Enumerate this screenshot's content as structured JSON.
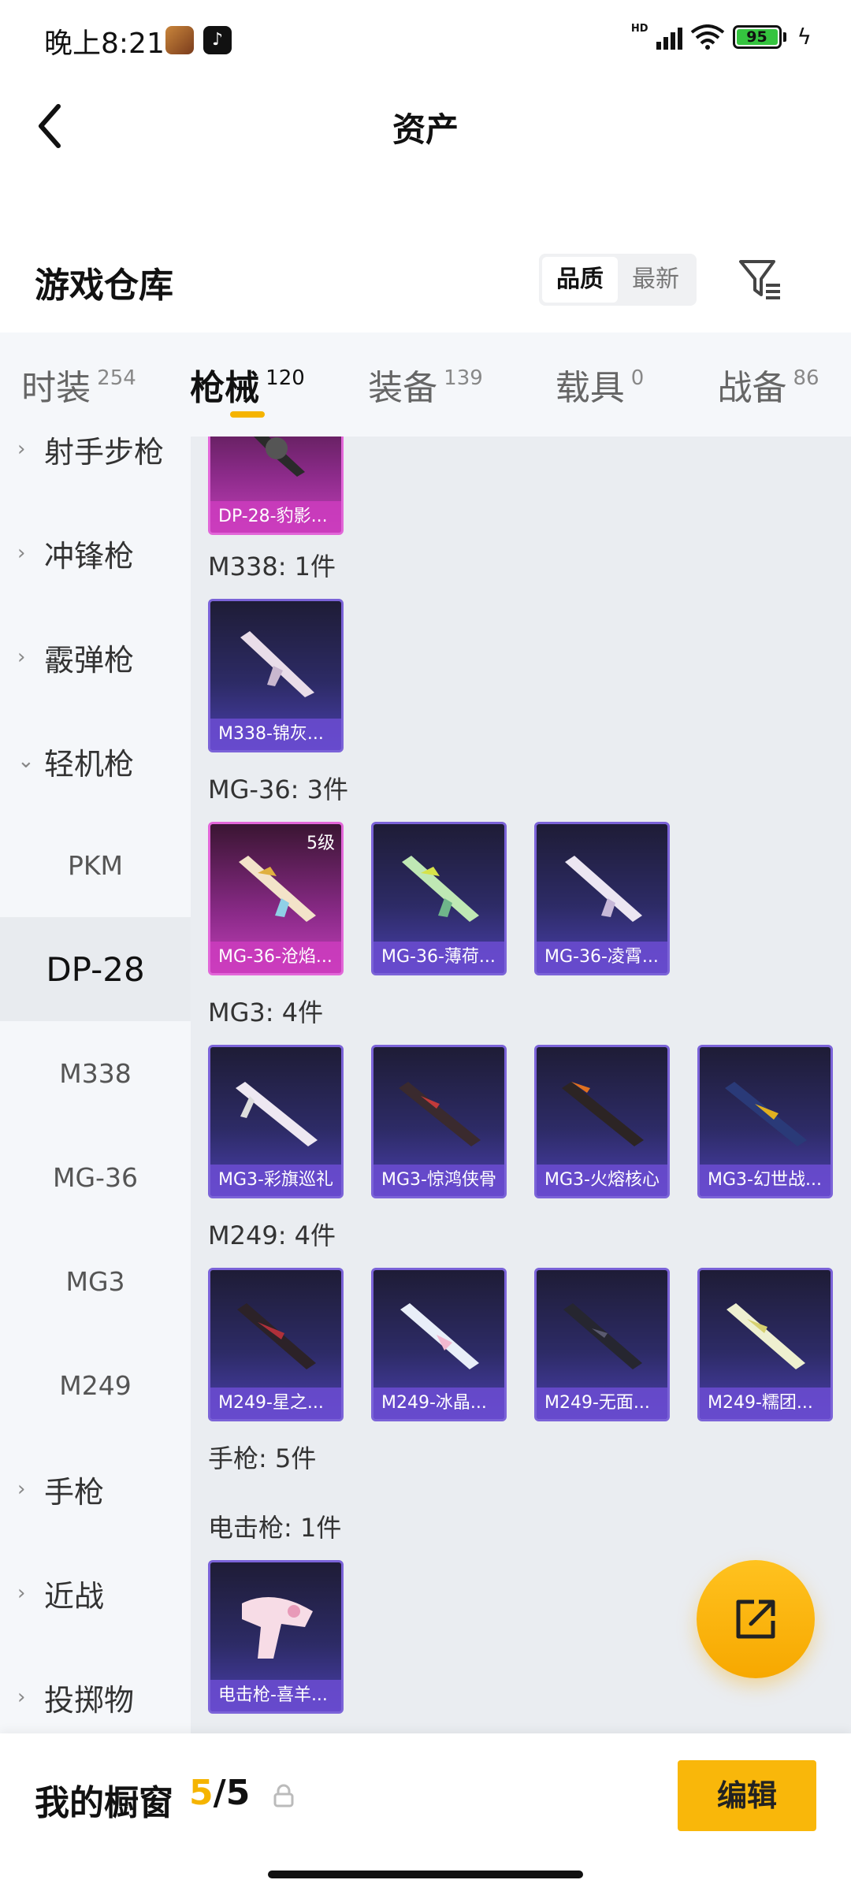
{
  "status": {
    "time": "晚上8:21",
    "hd": "HD",
    "battery": "95"
  },
  "header": {
    "title": "资产"
  },
  "warehouse": {
    "title": "游戏仓库",
    "sort_options": [
      "品质",
      "最新"
    ],
    "active_sort": "品质"
  },
  "tabs": [
    {
      "label": "时装",
      "count": "254"
    },
    {
      "label": "枪械",
      "count": "120"
    },
    {
      "label": "装备",
      "count": "139"
    },
    {
      "label": "载具",
      "count": "0"
    },
    {
      "label": "战备",
      "count": "86"
    }
  ],
  "active_tab": "枪械",
  "sidebar": {
    "items": [
      {
        "label": "射手步枪",
        "type": "category"
      },
      {
        "label": "冲锋枪",
        "type": "category"
      },
      {
        "label": "霰弹枪",
        "type": "category"
      },
      {
        "label": "轻机枪",
        "type": "category",
        "expanded": true
      },
      {
        "label": "PKM",
        "type": "sub"
      },
      {
        "label": "DP-28",
        "type": "sub",
        "selected": true
      },
      {
        "label": "M338",
        "type": "sub"
      },
      {
        "label": "MG-36",
        "type": "sub"
      },
      {
        "label": "MG3",
        "type": "sub"
      },
      {
        "label": "M249",
        "type": "sub"
      },
      {
        "label": "手枪",
        "type": "category"
      },
      {
        "label": "近战",
        "type": "category"
      },
      {
        "label": "投掷物",
        "type": "category"
      }
    ]
  },
  "groups": [
    {
      "title": "",
      "items": [
        {
          "name": "DP-28-豹影...",
          "rarity": "pink"
        }
      ]
    },
    {
      "title": "M338: 1件",
      "items": [
        {
          "name": "M338-锦灰...",
          "rarity": "purple"
        }
      ]
    },
    {
      "title": "MG-36: 3件",
      "items": [
        {
          "name": "MG-36-沧焰...",
          "rarity": "pink",
          "level": "5级"
        },
        {
          "name": "MG-36-薄荷...",
          "rarity": "purple"
        },
        {
          "name": "MG-36-凌霄...",
          "rarity": "purple"
        }
      ]
    },
    {
      "title": "MG3: 4件",
      "items": [
        {
          "name": "MG3-彩旗巡礼",
          "rarity": "purple"
        },
        {
          "name": "MG3-惊鸿侠骨",
          "rarity": "purple"
        },
        {
          "name": "MG3-火熔核心",
          "rarity": "purple"
        },
        {
          "name": "MG3-幻世战...",
          "rarity": "purple"
        }
      ]
    },
    {
      "title": "M249: 4件",
      "items": [
        {
          "name": "M249-星之...",
          "rarity": "purple"
        },
        {
          "name": "M249-冰晶...",
          "rarity": "purple"
        },
        {
          "name": "M249-无面...",
          "rarity": "purple"
        },
        {
          "name": "M249-糯团...",
          "rarity": "purple"
        }
      ]
    },
    {
      "title": "手枪: 5件",
      "items": []
    },
    {
      "title": "电击枪: 1件",
      "items": [
        {
          "name": "电击枪-喜羊...",
          "rarity": "purple"
        }
      ]
    }
  ],
  "bottom": {
    "label": "我的橱窗",
    "current": "5",
    "separator": "/",
    "total": "5",
    "edit": "编辑"
  },
  "colors": {
    "accent": "#f5b400",
    "purple_card": "#7b63d8",
    "pink_card": "#e266d8"
  },
  "icons": {
    "back": "chevron-left-icon",
    "filter": "filter-icon",
    "share": "share-icon",
    "lock": "lock-icon"
  }
}
